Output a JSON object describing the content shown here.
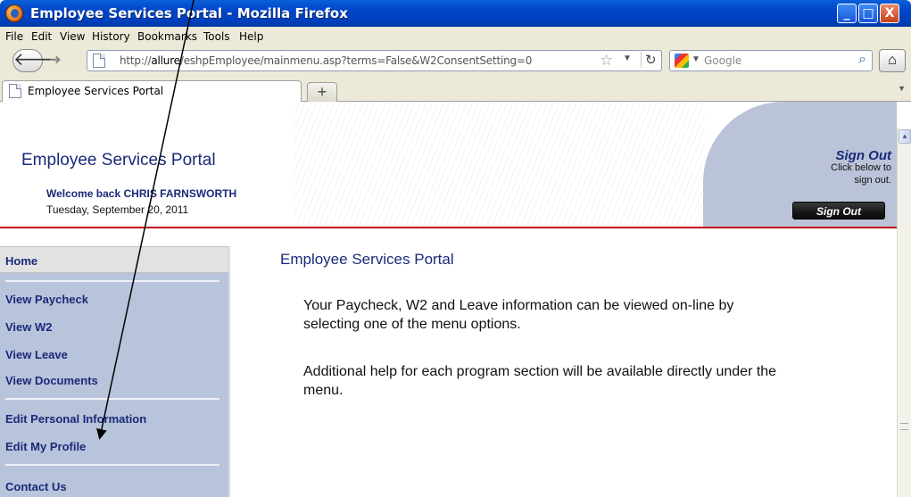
{
  "window": {
    "title": "Employee Services Portal - Mozilla Firefox",
    "controls": [
      "_",
      "□",
      "X"
    ]
  },
  "menu": [
    "File",
    "Edit",
    "View",
    "History",
    "Bookmarks",
    "Tools",
    "Help"
  ],
  "navbar": {
    "url_prefix": "http://",
    "url_host": "allure",
    "url_path": "/eshpEmployee/mainmenu.asp?terms=False&W2ConsentSetting=0",
    "search_placeholder": "Google"
  },
  "tabs": [
    {
      "label": "Employee Services Portal"
    }
  ],
  "header": {
    "title": "Employee Services Portal",
    "welcome": "Welcome back CHRIS FARNSWORTH",
    "date": "Tuesday, September 20, 2011",
    "signout_title": "Sign Out",
    "signout_line1": "Click below to",
    "signout_line2": "sign out.",
    "signout_button": "Sign Out"
  },
  "sidebar": {
    "items": [
      {
        "label": "Home"
      },
      {
        "label": "View Paycheck"
      },
      {
        "label": "View W2"
      },
      {
        "label": "View Leave"
      },
      {
        "label": "View Documents"
      },
      {
        "label": "Edit Personal Information"
      },
      {
        "label": "Edit My Profile"
      },
      {
        "label": "Contact Us"
      }
    ]
  },
  "main": {
    "title": "Employee Services Portal",
    "paragraphs": [
      "Your Paycheck, W2 and Leave information can be viewed on-line by selecting one of the menu options.",
      "Additional help for each program section will be available directly under the menu."
    ]
  },
  "colors": {
    "navy_text": "#1a2a78",
    "sidebar_bg": "#b8c4dc",
    "rule_red": "#c0141c",
    "signout_panel": "#bac3d8"
  },
  "icons": [
    "firefox-icon",
    "back-icon",
    "forward-icon",
    "page-icon",
    "star-icon",
    "reload-icon",
    "google-icon",
    "search-icon",
    "home-icon",
    "new-tab-icon"
  ]
}
